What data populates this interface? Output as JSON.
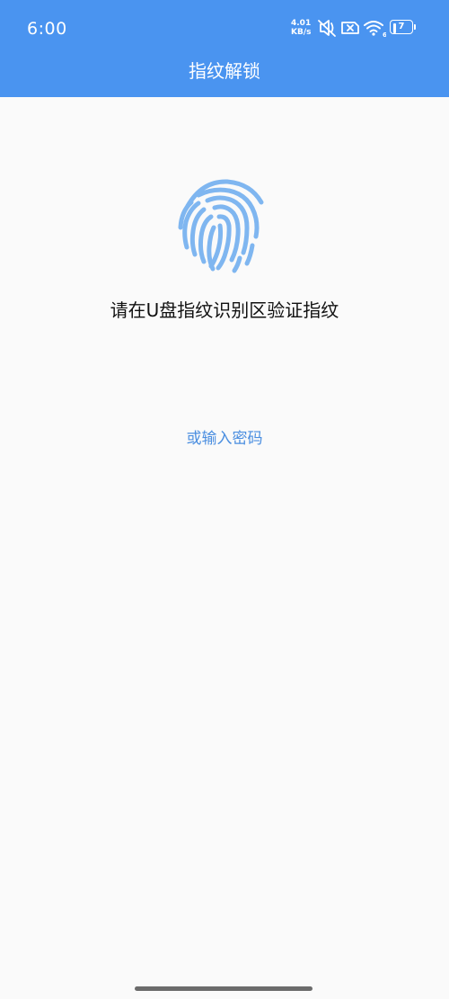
{
  "status_bar": {
    "time": "6:00",
    "net_speed_value": "4.01",
    "net_speed_unit": "KB/s",
    "battery_level": "7",
    "icons": [
      "mute-icon",
      "sim-icon",
      "wifi-icon",
      "battery-icon"
    ]
  },
  "header": {
    "title": "指纹解锁",
    "background_color": "#4a94f0"
  },
  "main": {
    "fingerprint_icon": "fingerprint-icon",
    "fingerprint_color": "#7fb6f0",
    "prompt": "请在U盘指纹识别区验证指纹",
    "password_link": "或输入密码",
    "link_color": "#4a8ee0"
  }
}
